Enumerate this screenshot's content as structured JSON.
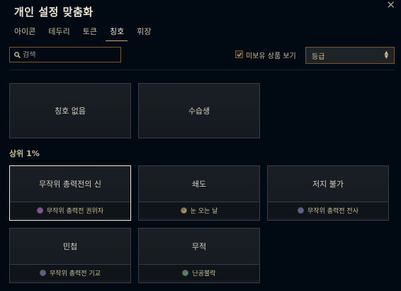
{
  "window": {
    "title": "개인 설정 맞춤화",
    "close_glyph": "✕"
  },
  "tabs": [
    {
      "label": "아이콘",
      "active": false
    },
    {
      "label": "테두리",
      "active": false
    },
    {
      "label": "토큰",
      "active": false
    },
    {
      "label": "칭호",
      "active": true
    },
    {
      "label": "휘장",
      "active": false
    }
  ],
  "filters": {
    "search_placeholder": "검색",
    "checkbox_label": "미보유 상품 보기",
    "checkbox_checked": true,
    "sort_value": "등급"
  },
  "top_cards": [
    {
      "label": "칭호 없음"
    },
    {
      "label": "수습생"
    }
  ],
  "section": {
    "label": "상위 1%"
  },
  "cards": [
    {
      "label": "무작위 총력전의 신",
      "sub": "무작위 총력전 권위자",
      "gem_color": "#b03cc8",
      "selected": true
    },
    {
      "label": "쇄도",
      "sub": "눈 오는 날",
      "gem_color": "#c8964b",
      "selected": false
    },
    {
      "label": "저지 불가",
      "sub": "무작위 총력전 전사",
      "gem_color": "#5a5ab4",
      "selected": false
    },
    {
      "label": "민첩",
      "sub": "무작위 총력전 기교",
      "gem_color": "#5a5ab4",
      "selected": false
    },
    {
      "label": "무적",
      "sub": "난공불락",
      "gem_color": "#3ca05a",
      "selected": false
    }
  ],
  "colors": {
    "accent": "#c8aa6e",
    "border": "#785a28",
    "background": "#010a13"
  }
}
